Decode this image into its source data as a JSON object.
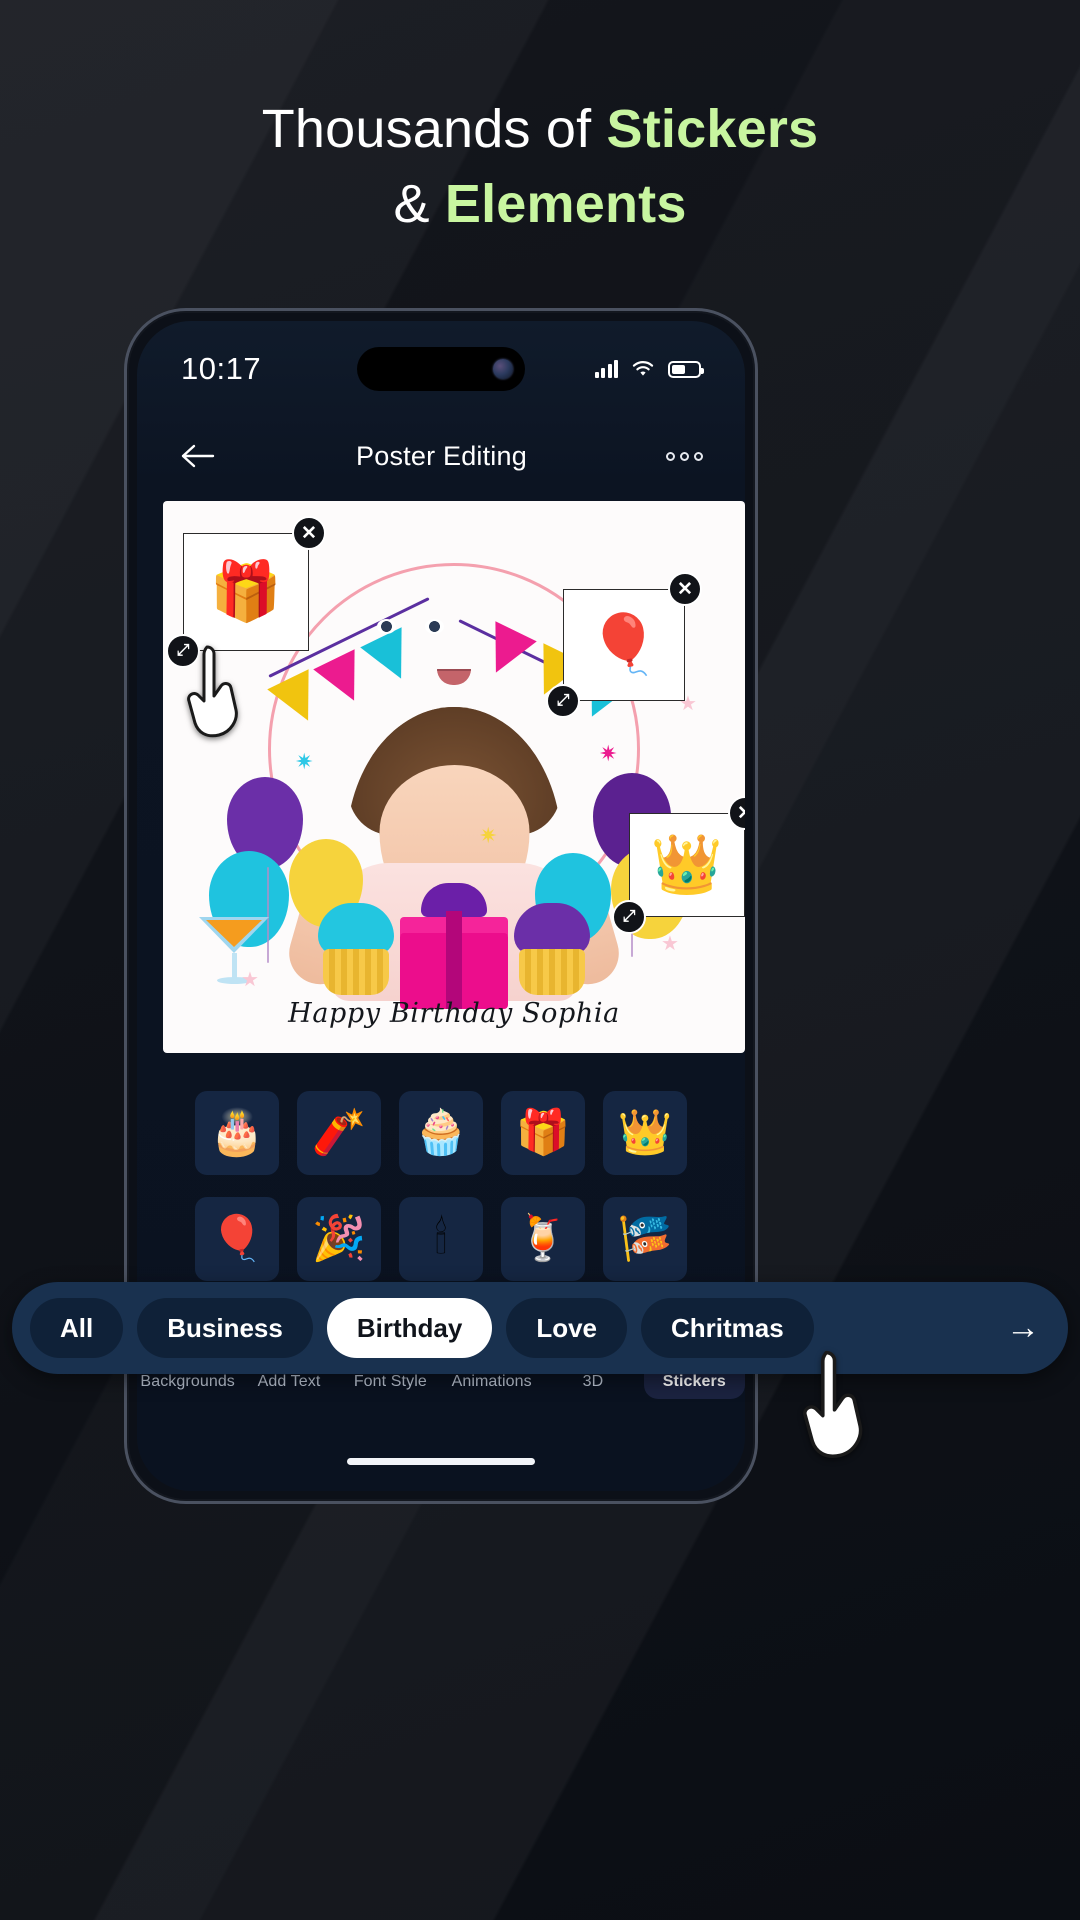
{
  "promo": {
    "line1_plain": "Thousands of ",
    "line1_bold": "Stickers",
    "line2_plain": "& ",
    "line2_bold": "Elements",
    "accent_color": "#c8f5a0"
  },
  "status_bar": {
    "time": "10:17",
    "signal_icon": "cellular-signal-icon",
    "wifi_icon": "wifi-icon",
    "battery_icon": "battery-icon",
    "battery_level": "52%"
  },
  "app_header": {
    "back_icon": "back-arrow-icon",
    "title": "Poster Editing",
    "more_icon": "more-options-icon"
  },
  "canvas": {
    "caption": "Happy Birthday Sophia",
    "placed_stickers": [
      {
        "name": "gift",
        "glyph": "🎁",
        "delete_label": "✕",
        "resize_label": "⤢"
      },
      {
        "name": "balloons",
        "glyph": "🎈",
        "delete_label": "✕",
        "resize_label": "⤢"
      },
      {
        "name": "crown",
        "glyph": "👑",
        "delete_label": "✕",
        "resize_label": "⤢"
      }
    ]
  },
  "categories": {
    "items": [
      {
        "label": "All",
        "active": false
      },
      {
        "label": "Business",
        "active": false
      },
      {
        "label": "Birthday",
        "active": true
      },
      {
        "label": "Love",
        "active": false
      },
      {
        "label": "Chritmas",
        "active": false
      }
    ],
    "next_arrow": "→",
    "pill_color": "#19314f",
    "active_color": "#ffffff"
  },
  "sticker_grid": {
    "row1": [
      {
        "name": "birthday-cake",
        "glyph": "🎂"
      },
      {
        "name": "firework-rocket",
        "glyph": "🧨"
      },
      {
        "name": "cupcake",
        "glyph": "🧁"
      },
      {
        "name": "gift-box",
        "glyph": "🎁"
      },
      {
        "name": "crown",
        "glyph": "👑"
      }
    ],
    "row2": [
      {
        "name": "balloons",
        "glyph": "🎈"
      },
      {
        "name": "party-hat",
        "glyph": "🎉"
      },
      {
        "name": "candle",
        "glyph": "🕯"
      },
      {
        "name": "cocktail",
        "glyph": "🍹"
      },
      {
        "name": "bunting-flags",
        "glyph": "🎏"
      }
    ]
  },
  "bottom_nav": {
    "items": [
      {
        "label": "Backgrounds",
        "icon": "image-placeholder-icon",
        "active": false
      },
      {
        "label": "Add Text",
        "icon": "text-t-icon",
        "active": false
      },
      {
        "label": "Font Style",
        "icon": "double-a-icon",
        "active": false
      },
      {
        "label": "Animations",
        "icon": "mouse-head-icon",
        "active": false
      },
      {
        "label": "3D",
        "icon": "cube-cursor-icon",
        "active": false
      },
      {
        "label": "Stickers",
        "icon": "sticker-badge-icon",
        "active": true
      }
    ]
  }
}
